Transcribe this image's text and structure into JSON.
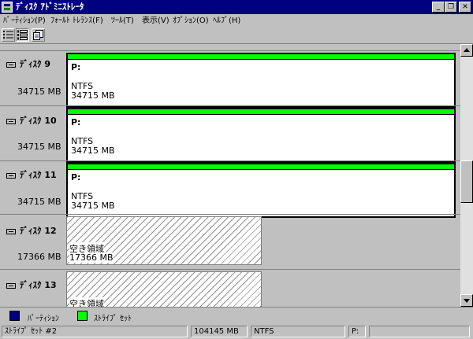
{
  "window": {
    "title": "ﾃﾞｨｽｸ ｱﾄﾞﾐﾆｽﾄﾚｰﾀ",
    "minimize": "_",
    "restore": "❐",
    "close": "✕"
  },
  "menu": [
    {
      "label": "ﾊﾟｰﾃｨｼｮﾝ(P)"
    },
    {
      "label": "ﾌｫｰﾙﾄ ﾄﾚﾗﾝｽ(F)"
    },
    {
      "label": "ﾂｰﾙ(T)"
    },
    {
      "label": "表示(V)"
    },
    {
      "label": "ｵﾌﾟｼｮﾝ(O)"
    },
    {
      "label": "ﾍﾙﾌﾟ(H)"
    }
  ],
  "toolbar": [
    {
      "icon": "volumes-view-icon",
      "pressed": false
    },
    {
      "icon": "disk-configuration-view-icon",
      "pressed": true
    },
    {
      "icon": "properties-icon",
      "pressed": false
    }
  ],
  "disks": [
    {
      "name": "ﾃﾞｨｽｸ 9",
      "size": "34715 MB",
      "partition": {
        "label": "P:",
        "fs": "NTFS",
        "size": "34715 MB"
      }
    },
    {
      "name": "ﾃﾞｨｽｸ 10",
      "size": "34715 MB",
      "partition": {
        "label": "P:",
        "fs": "NTFS",
        "size": "34715 MB"
      }
    },
    {
      "name": "ﾃﾞｨｽｸ 11",
      "size": "34715 MB",
      "partition": {
        "label": "P:",
        "fs": "NTFS",
        "size": "34715 MB"
      }
    },
    {
      "name": "ﾃﾞｨｽｸ 12",
      "size": "17366 MB",
      "free": {
        "label": "空き領域",
        "size": "17366 MB"
      }
    },
    {
      "name": "ﾃﾞｨｽｸ 13",
      "size": "",
      "free": {
        "label": "空き領域",
        "size": ""
      }
    }
  ],
  "legend": [
    {
      "label": "ﾊﾟｰﾃｨｼｮﾝ",
      "color": "#000080"
    },
    {
      "label": "ｽﾄﾗｲﾌﾟ ｾｯﾄ",
      "color": "#00ff00"
    }
  ],
  "status": {
    "selection": "ｽﾄﾗｲﾌﾟ ｾｯﾄ #2",
    "size": "104145 MB",
    "fs": "NTFS",
    "drive": "P:",
    "extra": ""
  },
  "colors": {
    "titlebar": "#000080",
    "stripe_set": "#00ff00",
    "partition": "#000080"
  }
}
